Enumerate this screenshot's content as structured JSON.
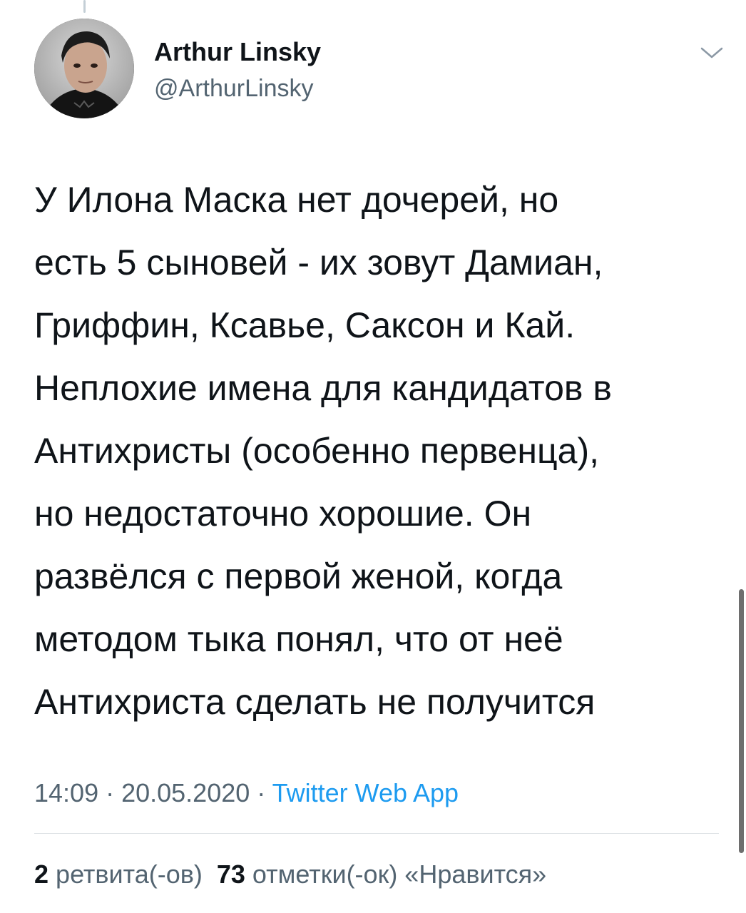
{
  "author": {
    "name": "Arthur Linsky",
    "handle": "@ArthurLinsky"
  },
  "icons": {
    "menu": "chevron-down-icon",
    "avatar": "avatar-photo"
  },
  "tweet": {
    "text": "У Илона Маска нет дочерей, но\nесть 5 сыновей - их зовут Дамиан,\nГриффин, Ксавье, Саксон и Кай.\nНеплохие имена для кандидатов в\nАнтихристы (особенно первенца),\nно недостаточно хорошие. Он\nразвёлся с первой женой, когда\nметодом тыка понял, что от неё\nАнтихриста сделать не получится",
    "time": "14:09",
    "separator": " · ",
    "date": "20.05.2020",
    "source": "Twitter Web App"
  },
  "stats": {
    "retweets_count": "2",
    "retweets_label": "ретвита(-ов)",
    "likes_count": "73",
    "likes_label": "отметки(-ок) «Нравится»"
  },
  "colors": {
    "text": "#0f1419",
    "secondary": "#536471",
    "link": "#1d9bf0",
    "divider": "#dfe3e6"
  }
}
